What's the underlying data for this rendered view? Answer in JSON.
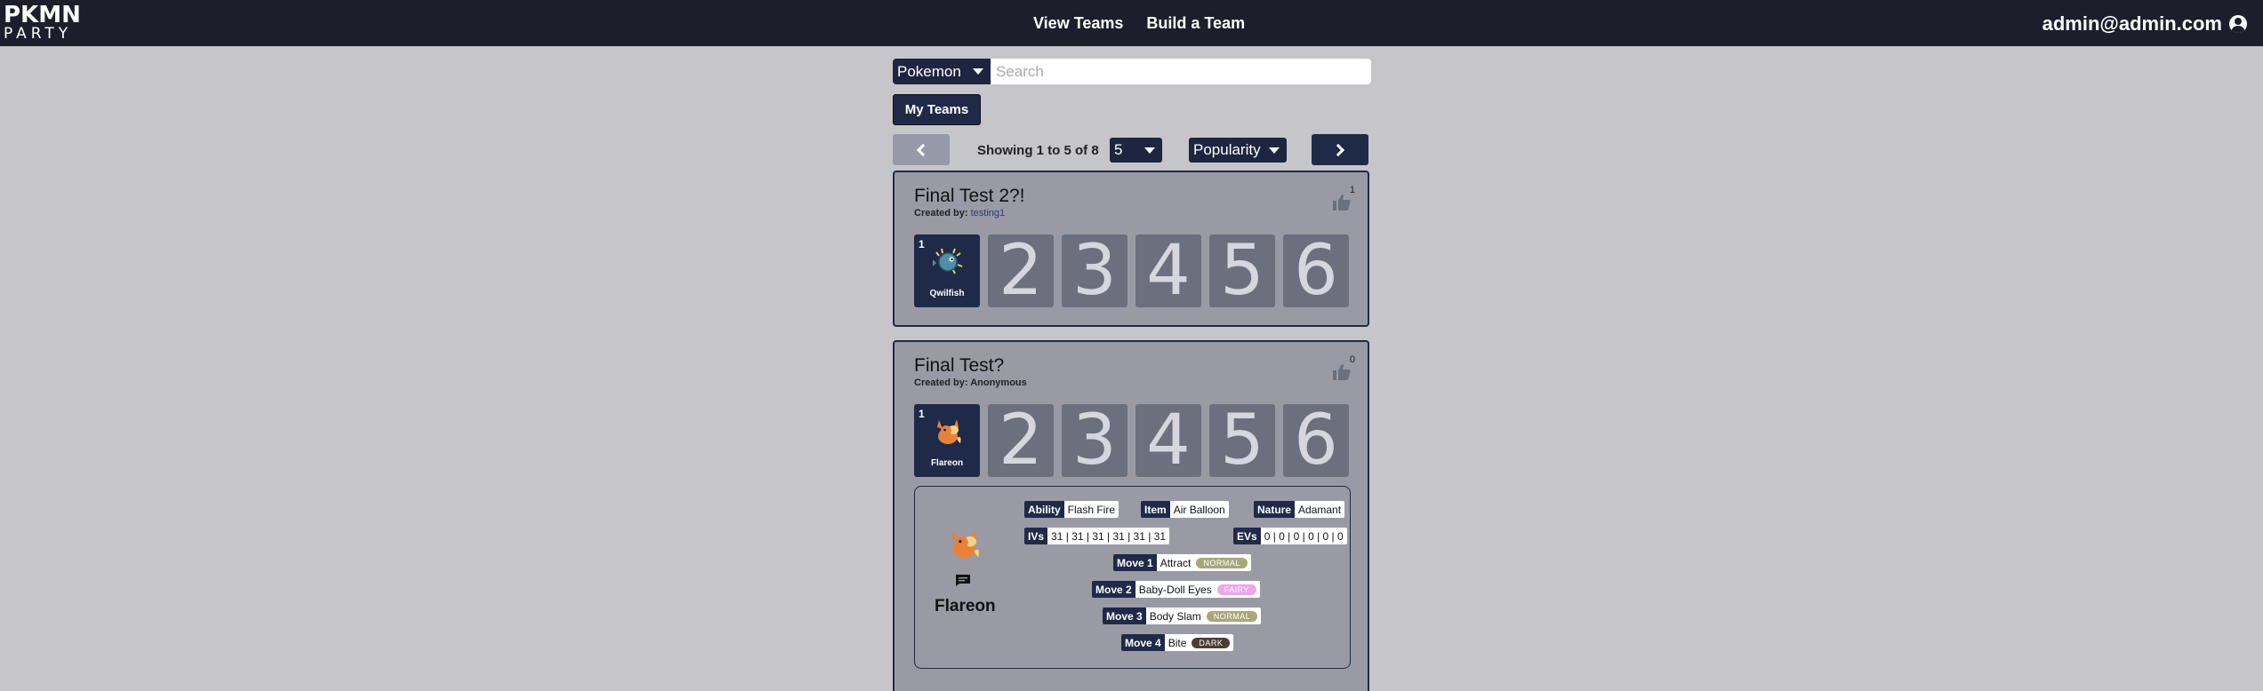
{
  "nav": {
    "logo_line1": "PKMN",
    "logo_line2": "PARTY",
    "links": [
      "View Teams",
      "Build a Team"
    ],
    "user": "admin@admin.com"
  },
  "search": {
    "category": "Pokemon",
    "placeholder": "Search",
    "value": ""
  },
  "my_teams_label": "My Teams",
  "pager": {
    "showing_text": "Showing 1 to 5 of 8",
    "per_page": "5",
    "sort": "Popularity"
  },
  "teams": [
    {
      "title": "Final Test 2?!",
      "created_by_label": "Created by:",
      "creator": "testing1",
      "likes": "1",
      "slot1": {
        "num": "1",
        "name": "Qwilfish"
      },
      "empty_slots": [
        "2",
        "3",
        "4",
        "5",
        "6"
      ]
    },
    {
      "title": "Final Test?",
      "created_by_label": "Created by:",
      "creator": "Anonymous",
      "likes": "0",
      "slot1": {
        "num": "1",
        "name": "Flareon"
      },
      "empty_slots": [
        "2",
        "3",
        "4",
        "5",
        "6"
      ],
      "detail": {
        "name": "Flareon",
        "ability_label": "Ability",
        "ability": "Flash Fire",
        "item_label": "Item",
        "item": "Air Balloon",
        "nature_label": "Nature",
        "nature": "Adamant",
        "ivs_label": "IVs",
        "ivs": "31 | 31 | 31 | 31 | 31 | 31",
        "evs_label": "EVs",
        "evs": "0 | 0 | 0 | 0 | 0 | 0",
        "moves": [
          {
            "label": "Move 1",
            "name": "Attract",
            "type": "NORMAL",
            "type_color": "#a8a77a"
          },
          {
            "label": "Move 2",
            "name": "Baby-Doll Eyes",
            "type": "FAIRY",
            "type_color": "#eea6e8"
          },
          {
            "label": "Move 3",
            "name": "Body Slam",
            "type": "NORMAL",
            "type_color": "#a8a77a"
          },
          {
            "label": "Move 4",
            "name": "Bite",
            "type": "DARK",
            "type_color": "#4d3d36"
          }
        ]
      }
    }
  ],
  "colors": {
    "navbar": "#1d1e2b",
    "background": "#c6c5ca",
    "card": "#999aa4",
    "accent": "#1f2a48",
    "empty_slot": "#6c6f7e"
  }
}
